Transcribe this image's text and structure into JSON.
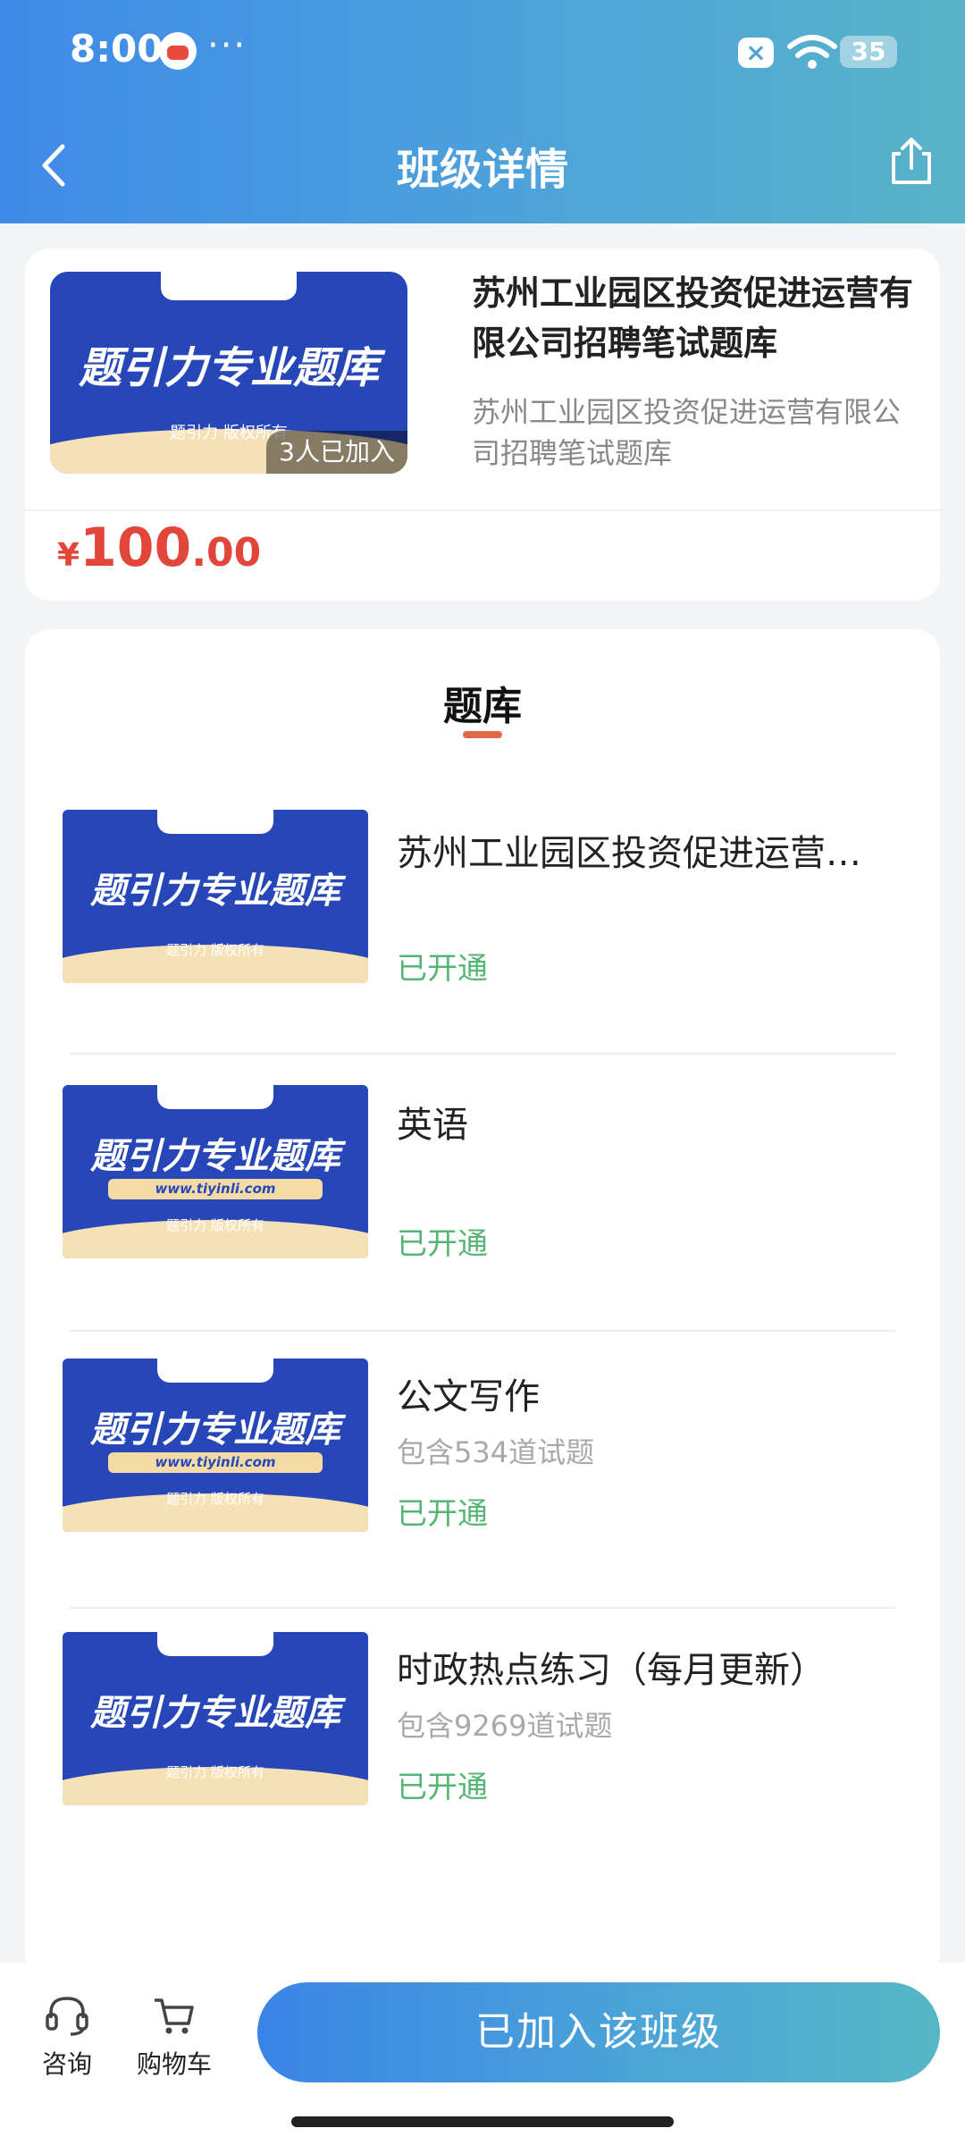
{
  "status_bar": {
    "time": "8:00",
    "dots": "···",
    "battery": "35"
  },
  "header": {
    "title": "班级详情"
  },
  "course": {
    "cover": {
      "title": "题引力专业题库",
      "copyright": "题引力 版权所有"
    },
    "joined": "3人已加入",
    "title": "苏州工业园区投资促进运营有限公司招聘笔试题库",
    "subtitle": "苏州工业园区投资促进运营有限公司招聘笔试题库",
    "price": {
      "currency": "¥",
      "integer": "100",
      "decimal": ".00"
    }
  },
  "bank": {
    "section_title": "题库",
    "items": [
      {
        "cover_title": "题引力专业题库",
        "cover_copyright": "题引力 版权所有",
        "cover_url": "",
        "name": "苏州工业园区投资促进运营…",
        "count": "",
        "status": "已开通"
      },
      {
        "cover_title": "题引力专业题库",
        "cover_copyright": "题引力 版权所有",
        "cover_url": "www.tiyinli.com",
        "name": "英语",
        "count": "",
        "status": "已开通"
      },
      {
        "cover_title": "题引力专业题库",
        "cover_copyright": "题引力 版权所有",
        "cover_url": "www.tiyinli.com",
        "name": "公文写作",
        "count": "包含534道试题",
        "status": "已开通"
      },
      {
        "cover_title": "题引力专业题库",
        "cover_copyright": "题引力 版权所有",
        "cover_url": "",
        "name": "时政热点练习（每月更新）",
        "count": "包含9269道试题",
        "status": "已开通"
      }
    ]
  },
  "bottom": {
    "consult": "咨询",
    "cart": "购物车",
    "join": "已加入该班级"
  },
  "colors": {
    "accent": "#3f8ae9",
    "price": "#e2463a",
    "status_green": "#54b574"
  }
}
